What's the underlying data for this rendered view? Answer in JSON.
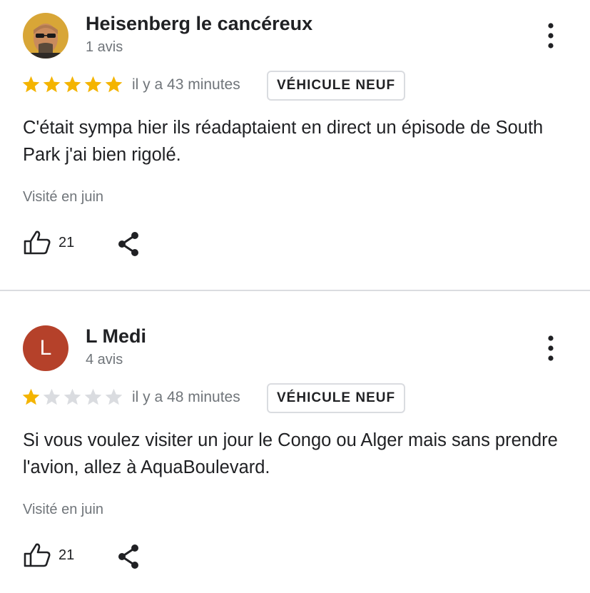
{
  "colors": {
    "star_filled": "#f4b400",
    "star_empty": "#dadce0",
    "secondary_text": "#70757a",
    "avatar_l_bg": "#b5412a"
  },
  "reviews": [
    {
      "author": "Heisenberg le cancéreux",
      "review_count": "1 avis",
      "avatar": "portrait-photo",
      "rating": 5,
      "max_rating": 5,
      "time": "il y a 43 minutes",
      "badge": "VÉHICULE NEUF",
      "text": "C'était sympa hier ils réadaptaient en direct un épisode de South Park j'ai bien rigolé.",
      "visited": "Visité en juin",
      "likes": "21"
    },
    {
      "author": "L Medi",
      "review_count": "4 avis",
      "avatar_letter": "L",
      "rating": 1,
      "max_rating": 5,
      "time": "il y a 48 minutes",
      "badge": "VÉHICULE NEUF",
      "text": "Si vous voulez visiter un jour le Congo ou Alger mais sans prendre l'avion, allez à AquaBoulevard.",
      "visited": "Visité en juin",
      "likes": "21"
    }
  ]
}
